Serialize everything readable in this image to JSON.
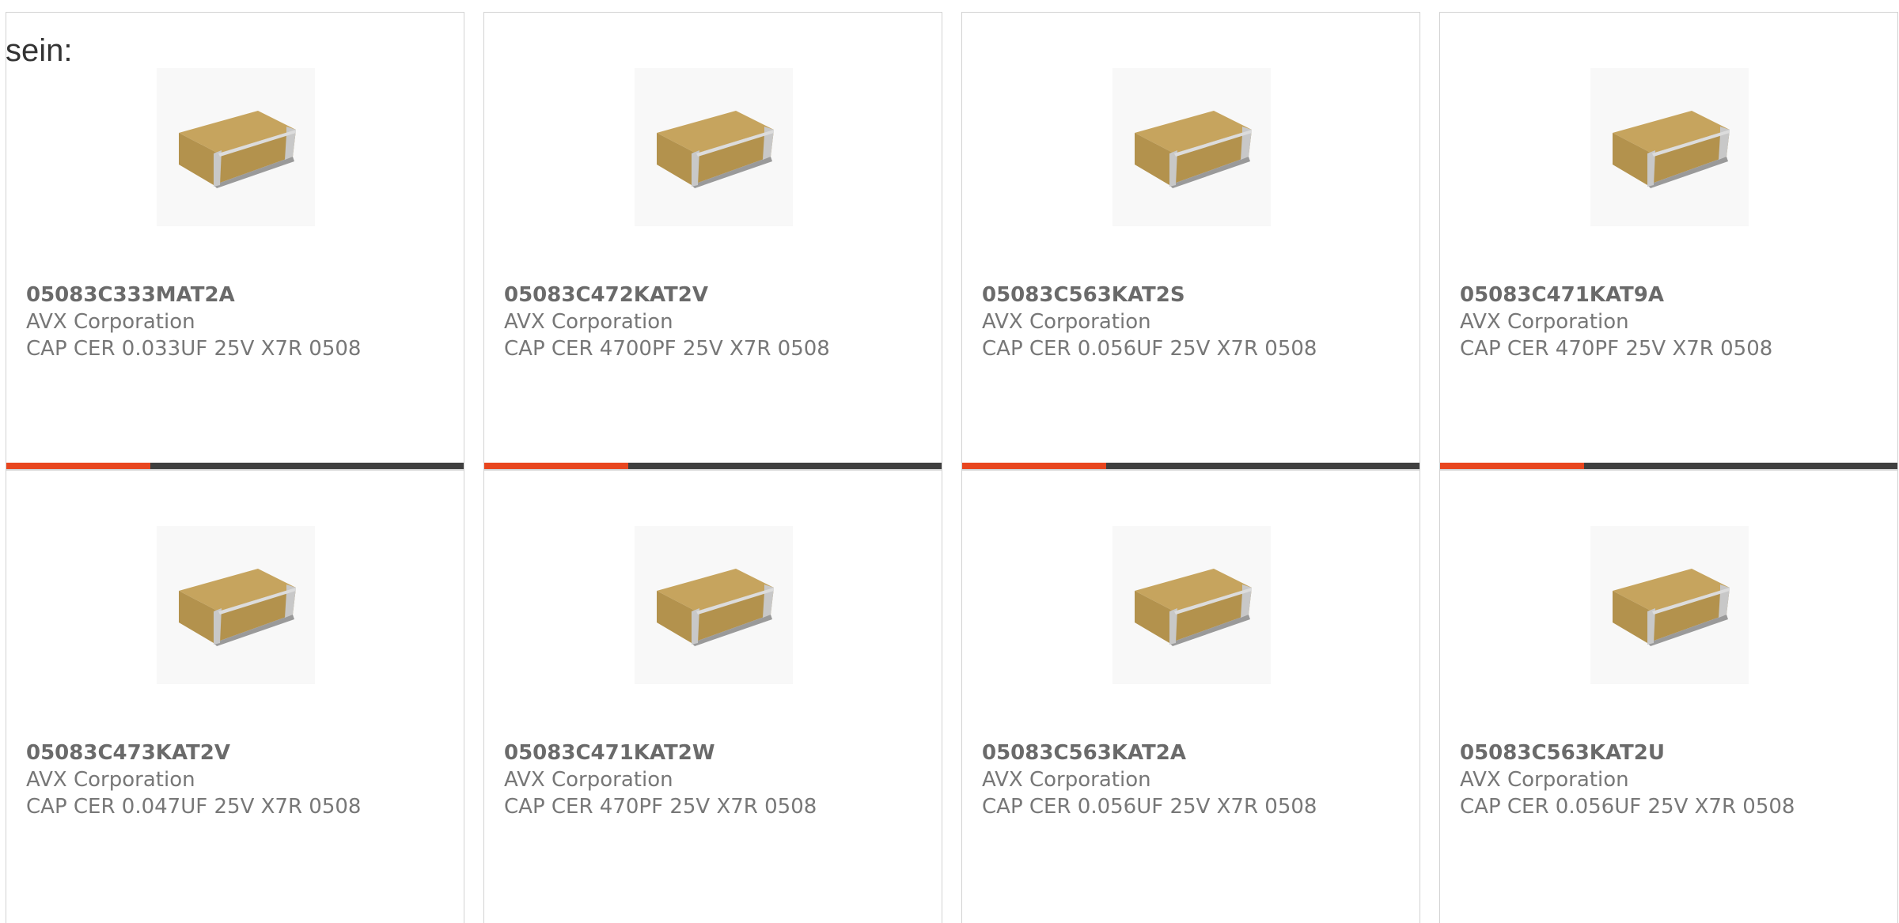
{
  "lead_text": "sein:",
  "colors": {
    "accent": "#e8461f",
    "bar_track": "#3f3f3f",
    "border": "#d2d2d2",
    "chip_body": "#b3924d",
    "chip_terminal": "#c8c8c8"
  },
  "products": [
    {
      "part_number": "05083C333MAT2A",
      "manufacturer": "AVX Corporation",
      "description": "CAP CER 0.033UF 25V X7R 0508",
      "image_icon": "ceramic-capacitor-chip",
      "progress": 0.315
    },
    {
      "part_number": "05083C472KAT2V",
      "manufacturer": "AVX Corporation",
      "description": "CAP CER 4700PF 25V X7R 0508",
      "image_icon": "ceramic-capacitor-chip",
      "progress": 0.315
    },
    {
      "part_number": "05083C563KAT2S",
      "manufacturer": "AVX Corporation",
      "description": "CAP CER 0.056UF 25V X7R 0508",
      "image_icon": "ceramic-capacitor-chip",
      "progress": 0.315
    },
    {
      "part_number": "05083C471KAT9A",
      "manufacturer": "AVX Corporation",
      "description": "CAP CER 470PF 25V X7R 0508",
      "image_icon": "ceramic-capacitor-chip",
      "progress": 0.315
    },
    {
      "part_number": "05083C473KAT2V",
      "manufacturer": "AVX Corporation",
      "description": "CAP CER 0.047UF 25V X7R 0508",
      "image_icon": "ceramic-capacitor-chip"
    },
    {
      "part_number": "05083C471KAT2W",
      "manufacturer": "AVX Corporation",
      "description": "CAP CER 470PF 25V X7R 0508",
      "image_icon": "ceramic-capacitor-chip"
    },
    {
      "part_number": "05083C563KAT2A",
      "manufacturer": "AVX Corporation",
      "description": "CAP CER 0.056UF 25V X7R 0508",
      "image_icon": "ceramic-capacitor-chip"
    },
    {
      "part_number": "05083C563KAT2U",
      "manufacturer": "AVX Corporation",
      "description": "CAP CER 0.056UF 25V X7R 0508",
      "image_icon": "ceramic-capacitor-chip"
    }
  ]
}
